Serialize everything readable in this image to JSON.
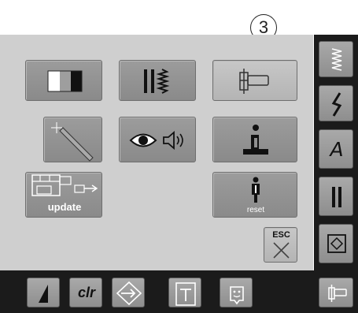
{
  "callout": {
    "number": "3"
  },
  "buttons": {
    "update_label": "update",
    "reset_label": "reset",
    "esc_label": "ESC"
  },
  "sidebar": {
    "letter_a": "A"
  },
  "bottombar": {
    "clr_label": "clr"
  },
  "icons": {
    "display_settings": "screen-contrast-icon",
    "stitch_settings": "stitch-width-icon",
    "sewing_foot": "presser-foot-icon",
    "calibration": "calibrate-screen-icon",
    "monitoring": "eye-sound-icon",
    "service": "service-icon",
    "update": "update-usb-icon",
    "reset": "reset-user-icon",
    "close": "close-x-icon"
  },
  "colors": {
    "panel": "#cfcfcf",
    "button_dark": "#8f8f8f",
    "button_light": "#bdbdbd",
    "frame": "#1b1b1b"
  }
}
